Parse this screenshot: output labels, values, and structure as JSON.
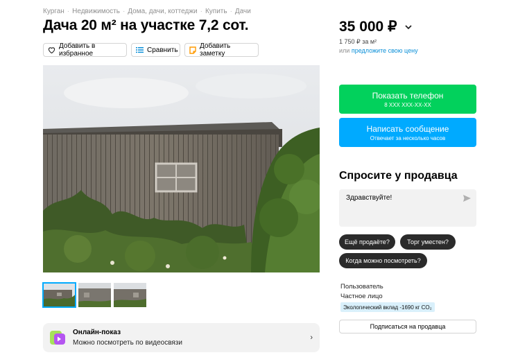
{
  "breadcrumbs": [
    "Курган",
    "Недвижимость",
    "Дома, дачи, коттеджи",
    "Купить",
    "Дачи"
  ],
  "title": "Дача 20 м² на участке 7,2 сот.",
  "actions": {
    "favorite": "Добавить в избранное",
    "compare": "Сравнить",
    "note": "Добавить заметку"
  },
  "price": {
    "value": "35 000 ₽",
    "per_m2": "1 750 ₽ за м²",
    "or": "или",
    "offer_link": "предложите свою цену"
  },
  "contact": {
    "phone_label": "Показать телефон",
    "phone_masked": "8 XXX XXX-XX-XX",
    "message_label": "Написать сообщение",
    "message_sub": "Отвечает за несколько часов"
  },
  "ask": {
    "heading": "Спросите у продавца",
    "message": "Здравствуйте!",
    "chips": [
      "Ещё продаёте?",
      "Торг уместен?",
      "Когда можно посмотреть?"
    ]
  },
  "seller": {
    "name": "Пользователь",
    "type": "Частное лицо",
    "eco": "Экологический вклад -1690 кг CO₂",
    "subscribe": "Подписаться на продавца"
  },
  "online": {
    "title": "Онлайн-показ",
    "subtitle": "Можно посмотреть по видеосвязи"
  },
  "colors": {
    "green": "#02d15c",
    "blue": "#00aaff",
    "link": "#0a8fd8"
  },
  "icons": [
    "heart-icon",
    "compare-icon",
    "note-icon",
    "chevron-down-icon",
    "send-icon",
    "video-call-icon",
    "chevron-right-icon"
  ]
}
